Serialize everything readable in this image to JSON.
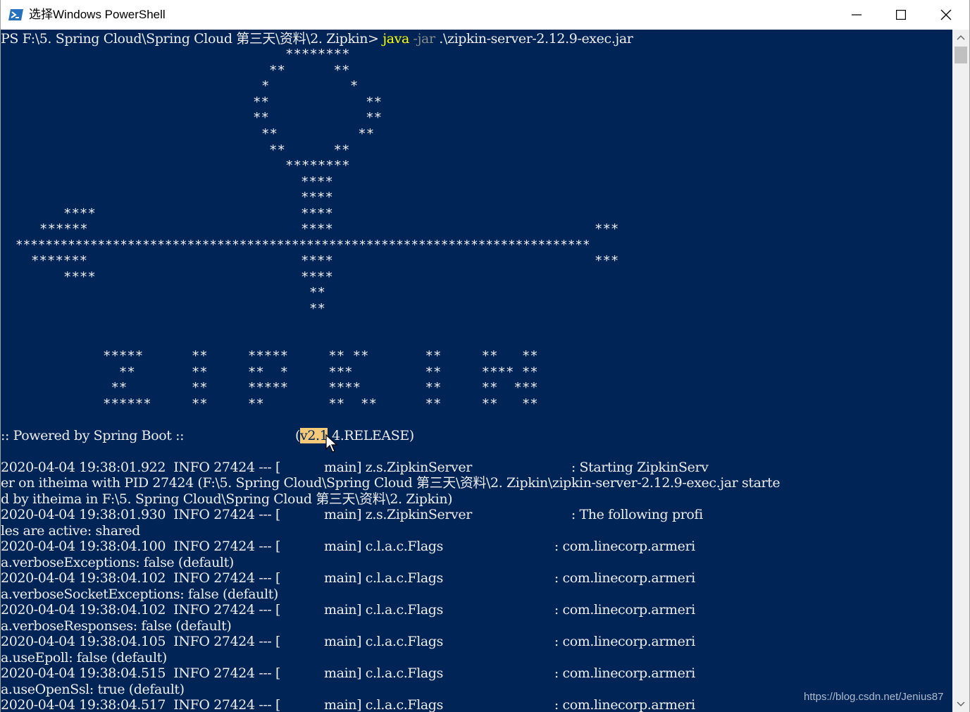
{
  "window": {
    "title": "选择Windows PowerShell",
    "icon": "powershell-icon",
    "controls": [
      "minimize-icon",
      "maximize-icon",
      "close-icon"
    ]
  },
  "colors": {
    "console_bg": "#012456",
    "console_text": "#eeedf0",
    "command_yellow": "#ffff00",
    "param_gray": "#8a8a8a",
    "selection": "#f5c97a"
  },
  "prompt": {
    "prefix": "PS F:\\5. Spring Cloud\\Spring Cloud 第三天\\资料\\2. Zipkin> ",
    "command": "java",
    "param": " -jar",
    "argument": " .\\zipkin-server-2.12.9-exec.jar"
  },
  "banner": {
    "logo_lines": [
      "********",
      "**      **",
      "*          *",
      "**            **",
      "**            **",
      "**          **",
      "**      **",
      "********",
      "****",
      "****",
      "****",
      "****",
      "*****************************************************************************",
      "****",
      "****",
      "**",
      "**"
    ],
    "left_wing": [
      "****",
      "******",
      "*******",
      "****"
    ],
    "right_wing": [
      "***",
      "***"
    ],
    "word_lines": [
      "*****      **     *****     ** **       **     **   **",
      "  **       **     **  *     ***         **     **** **",
      " **        **     *****     ****        **     **  ***",
      "******     **     **        **  **      **     **   **"
    ]
  },
  "powered_by": {
    "text": ":: Powered by Spring Boot ::",
    "open_paren": "(",
    "selected": "v2.1",
    "rest": ".4.RELEASE)"
  },
  "log_lines": [
    "2020-04-04 19:38:01.922  INFO 27424 --- [           main] z.s.ZipkinServer                         : Starting ZipkinServ",
    "er on itheima with PID 27424 (F:\\5. Spring Cloud\\Spring Cloud 第三天\\资料\\2. Zipkin\\zipkin-server-2.12.9-exec.jar starte",
    "d by itheima in F:\\5. Spring Cloud\\Spring Cloud 第三天\\资料\\2. Zipkin)",
    "2020-04-04 19:38:01.930  INFO 27424 --- [           main] z.s.ZipkinServer                         : The following profi",
    "les are active: shared",
    "2020-04-04 19:38:04.100  INFO 27424 --- [           main] c.l.a.c.Flags                            : com.linecorp.armeri",
    "a.verboseExceptions: false (default)",
    "2020-04-04 19:38:04.102  INFO 27424 --- [           main] c.l.a.c.Flags                            : com.linecorp.armeri",
    "a.verboseSocketExceptions: false (default)",
    "2020-04-04 19:38:04.102  INFO 27424 --- [           main] c.l.a.c.Flags                            : com.linecorp.armeri",
    "a.verboseResponses: false (default)",
    "2020-04-04 19:38:04.105  INFO 27424 --- [           main] c.l.a.c.Flags                            : com.linecorp.armeri",
    "a.useEpoll: false (default)",
    "2020-04-04 19:38:04.515  INFO 27424 --- [           main] c.l.a.c.Flags                            : com.linecorp.armeri",
    "a.useOpenSsl: true (default)",
    "2020-04-04 19:38:04.517  INFO 27424 --- [           main] c.l.a.c.Flags                            : com.linecorp.armeri"
  ],
  "watermark": "https://blog.csdn.net/Jenius87"
}
